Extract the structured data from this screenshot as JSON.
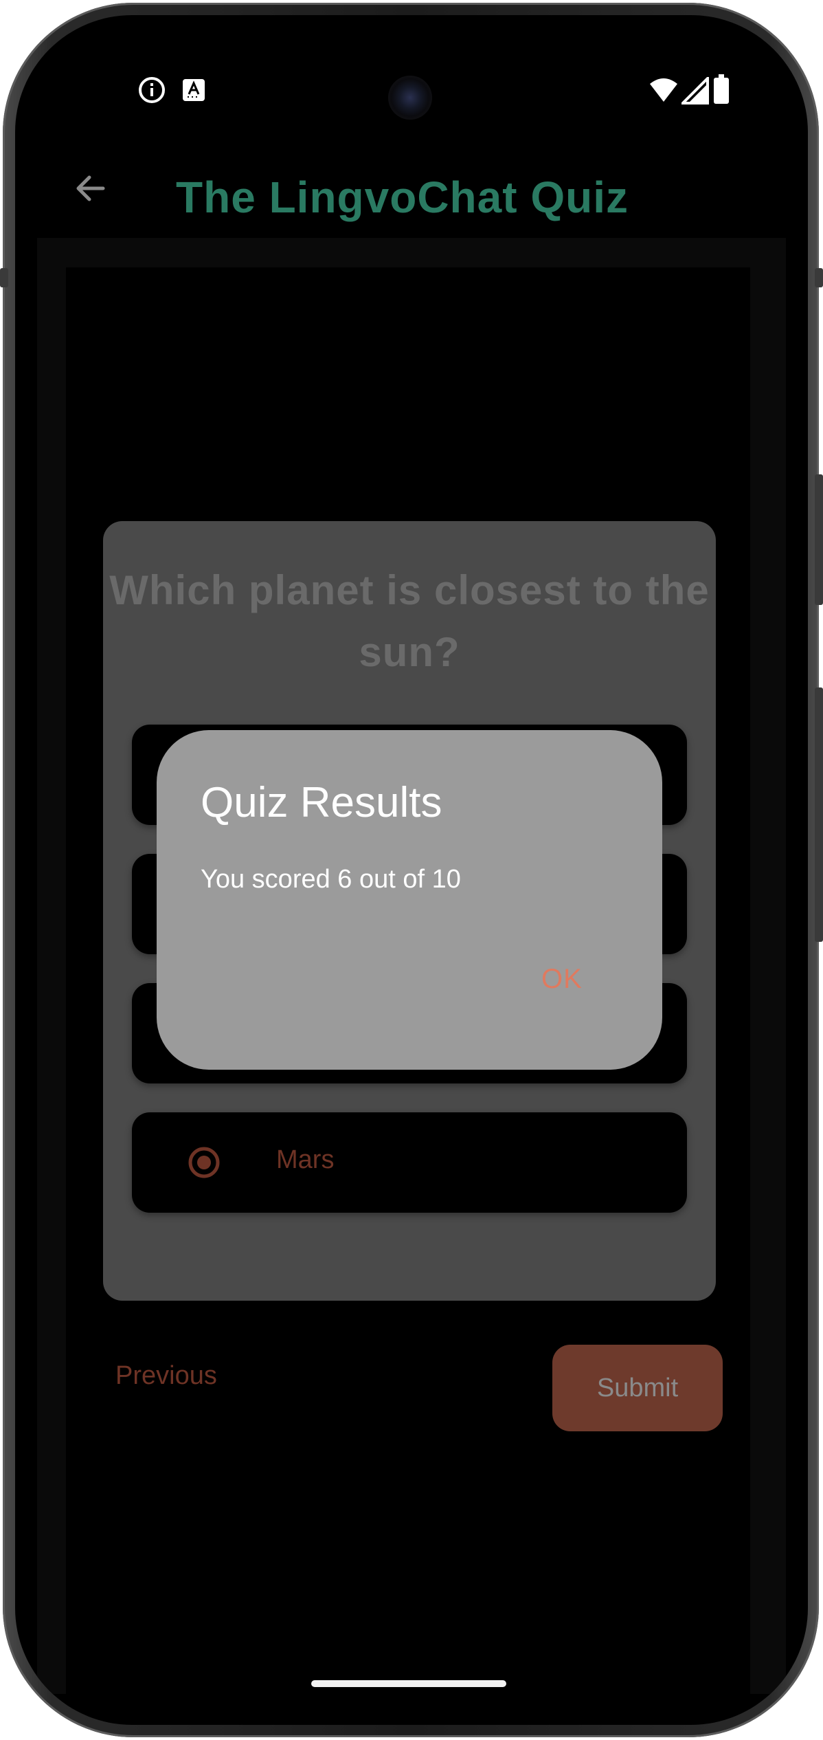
{
  "app_bar": {
    "title": "The LingvoChat Quiz",
    "back_icon": "arrow-back-icon",
    "title_color": "#2a7a62"
  },
  "status_bar": {
    "left_icons": [
      "info-icon",
      "text-recognition-icon"
    ],
    "right_icons": [
      "wifi-icon",
      "cellular-signal-icon",
      "battery-icon"
    ]
  },
  "quiz": {
    "question": "Which planet is closest to the sun?",
    "options": [
      {
        "label": ""
      },
      {
        "label": ""
      },
      {
        "label": ""
      },
      {
        "label": "Mars",
        "selected": true
      }
    ],
    "previous_label": "Previous",
    "submit_label": "Submit",
    "accent_color": "#6e3325"
  },
  "dialog": {
    "title": "Quiz Results",
    "message": "You scored 6 out of 10",
    "ok_label": "OK",
    "ok_color": "#e07a5f"
  }
}
